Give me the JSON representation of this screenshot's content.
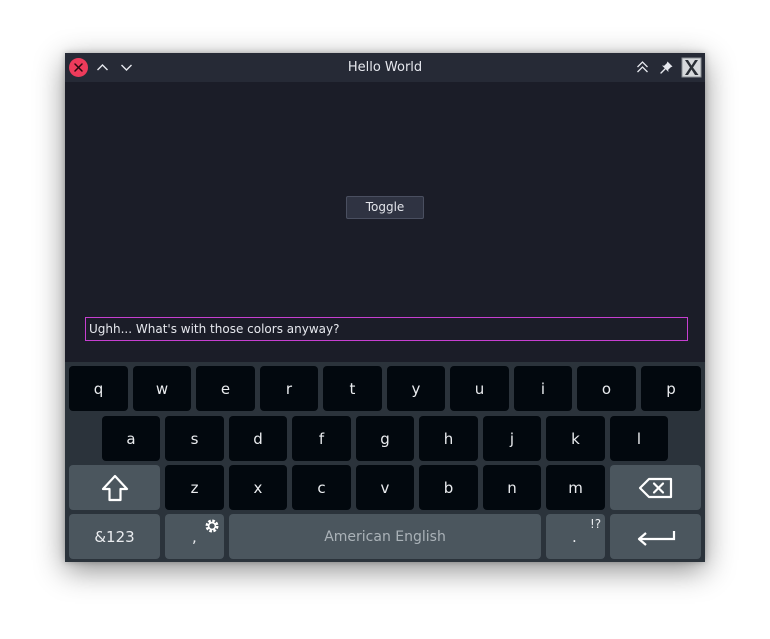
{
  "window": {
    "title": "Hello World"
  },
  "content": {
    "toggle_label": "Toggle",
    "text_field_value": "Ughh... What's with those colors anyway?"
  },
  "keyboard": {
    "row1": [
      "q",
      "w",
      "e",
      "r",
      "t",
      "y",
      "u",
      "i",
      "o",
      "p"
    ],
    "row2": [
      "a",
      "s",
      "d",
      "f",
      "g",
      "h",
      "j",
      "k",
      "l"
    ],
    "row3": [
      "z",
      "x",
      "c",
      "v",
      "b",
      "n",
      "m"
    ],
    "mode_key_label": "&123",
    "comma_key_label": ",",
    "period_key_label": ".",
    "punctuation_hint": "!?",
    "space_label": "American English"
  },
  "icons": {
    "close": "close-icon",
    "minimize": "chevron-up-icon",
    "maximize": "chevron-down-icon",
    "keep_above": "keep-above-icon",
    "pin": "pin-icon",
    "app": "x-app-icon",
    "shift": "shift-icon",
    "backspace": "backspace-icon",
    "settings": "gear-icon",
    "enter": "enter-icon"
  },
  "colors": {
    "window_bg": "#1b1d28",
    "titlebar_bg": "#262a36",
    "close_button": "#ee3b5b",
    "text_field_border": "#c63fd0",
    "keyboard_bg": "#2b333b",
    "key_bg": "#02080e",
    "function_key_bg": "#4b565e"
  }
}
